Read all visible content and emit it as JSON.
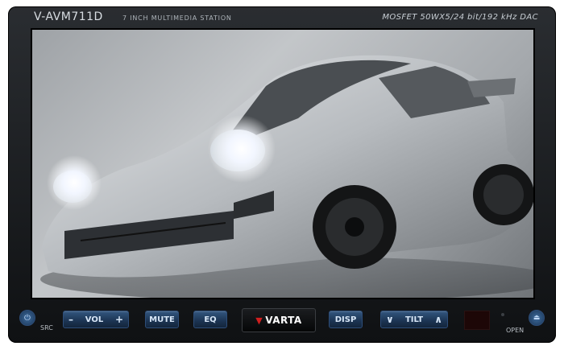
{
  "header": {
    "model": "V-AVM711D",
    "tagline": "7 INCH MULTIMEDIA STATION",
    "spec": "MOSFET 50WX5/24 bit/192 kHz DAC"
  },
  "controls": {
    "src_label": "SRC",
    "vol": {
      "minus": "–",
      "label": "VOL",
      "plus": "+"
    },
    "mute_label": "MUTE",
    "eq_label": "EQ",
    "brand": "VARTA",
    "disp_label": "DISP",
    "tilt": {
      "down": "∨",
      "label": "TILT",
      "up": "∧"
    },
    "open_label": "OPEN"
  },
  "icons": {
    "power": "power-icon",
    "eject": "eject-icon",
    "brand_mark": "varta-chevron-icon"
  },
  "colors": {
    "button_blue": "#1c3452",
    "button_text": "#d7e6f7",
    "brand_red": "#d11f1f"
  }
}
